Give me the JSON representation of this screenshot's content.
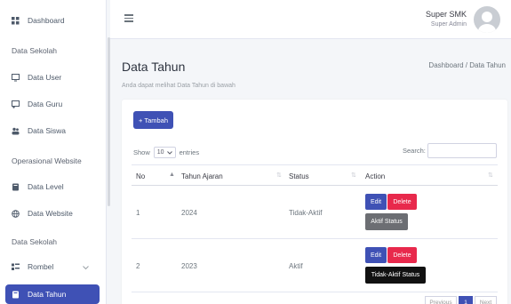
{
  "sidebar": {
    "dashboard": "Dashboard",
    "section1": "Data Sekolah",
    "data_user": "Data User",
    "data_guru": "Data Guru",
    "data_siswa": "Data Siswa",
    "section2": "Operasional Website",
    "data_level": "Data Level",
    "data_website": "Data Website",
    "section3": "Data Sekolah",
    "rombel": "Rombel",
    "data_tahun": "Data Tahun"
  },
  "topbar": {
    "user_name": "Super SMK",
    "user_role": "Super Admin"
  },
  "page": {
    "title": "Data Tahun",
    "subtitle": "Anda dapat melihat Data Tahun di bawah",
    "breadcrumb": "Dashboard / Data Tahun"
  },
  "toolbar": {
    "add_label": "+ Tambah",
    "show_label": "Show",
    "show_value": "10",
    "entries_label": "entries",
    "search_label": "Search:"
  },
  "table": {
    "headers": [
      "No",
      "Tahun Ajaran",
      "Status",
      "Action"
    ],
    "rows": [
      {
        "no": "1",
        "tahun": "2024",
        "status": "Tidak-Aktif",
        "edit": "Edit",
        "delete": "Delete",
        "toggle": "Aktif Status"
      },
      {
        "no": "2",
        "tahun": "2023",
        "status": "Aktif",
        "edit": "Edit",
        "delete": "Delete",
        "toggle": "Tidak-Aktif Status"
      }
    ]
  },
  "pagination": {
    "prev": "Previous",
    "current": "1",
    "next": "Next"
  },
  "colors": {
    "primary": "#3f51b5",
    "danger": "#e8294c",
    "secondary": "#6c6e73",
    "dark": "#111111"
  }
}
